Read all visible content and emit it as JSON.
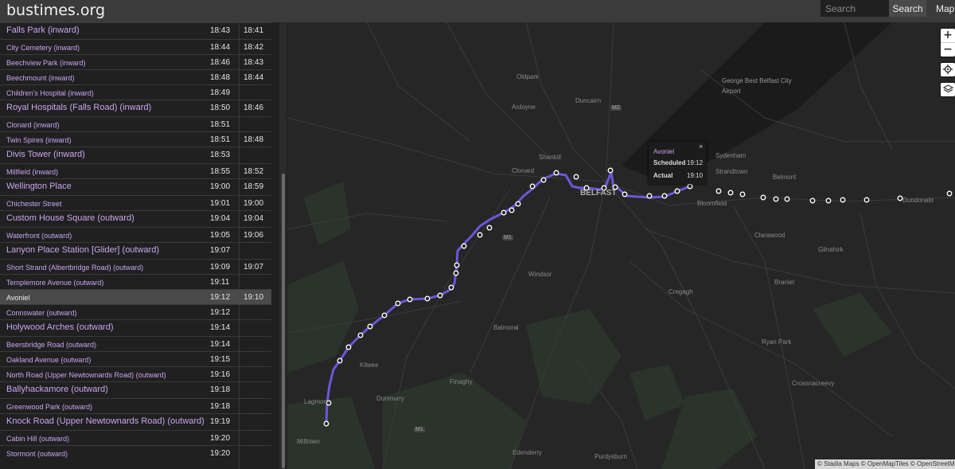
{
  "header": {
    "logo": "bustimes.org",
    "search_placeholder": "Search",
    "search_button": "Search",
    "map_link": "Map"
  },
  "timetable": [
    {
      "stop": "Falls Park (inward)",
      "major": true,
      "scheduled": "18:43",
      "actual": "18:41"
    },
    {
      "stop": "City Cemetery (inward)",
      "major": false,
      "scheduled": "18:44",
      "actual": "18:42"
    },
    {
      "stop": "Beechview Park (inward)",
      "major": false,
      "scheduled": "18:46",
      "actual": "18:43"
    },
    {
      "stop": "Beechmount (inward)",
      "major": false,
      "scheduled": "18:48",
      "actual": "18:44"
    },
    {
      "stop": "Children's Hospital (inward)",
      "major": false,
      "scheduled": "18:49",
      "actual": ""
    },
    {
      "stop": "Royal Hospitals (Falls Road) (inward)",
      "major": true,
      "scheduled": "18:50",
      "actual": "18:46"
    },
    {
      "stop": "Clonard (inward)",
      "major": false,
      "scheduled": "18:51",
      "actual": ""
    },
    {
      "stop": "Twin Spires (inward)",
      "major": false,
      "scheduled": "18:51",
      "actual": "18:48"
    },
    {
      "stop": "Divis Tower (inward)",
      "major": true,
      "scheduled": "18:53",
      "actual": ""
    },
    {
      "stop": "Millfield (inward)",
      "major": false,
      "scheduled": "18:55",
      "actual": "18:52"
    },
    {
      "stop": "Wellington Place",
      "major": true,
      "scheduled": "19:00",
      "actual": "18:59"
    },
    {
      "stop": "Chichester Street",
      "major": false,
      "scheduled": "19:01",
      "actual": "19:00"
    },
    {
      "stop": "Custom House Square (outward)",
      "major": true,
      "scheduled": "19:04",
      "actual": "19:04"
    },
    {
      "stop": "Waterfront (outward)",
      "major": false,
      "scheduled": "19:05",
      "actual": "19:06"
    },
    {
      "stop": "Lanyon Place Station [Glider] (outward)",
      "major": true,
      "scheduled": "19:07",
      "actual": ""
    },
    {
      "stop": "Short Strand (Albertbridge Road) (outward)",
      "major": false,
      "scheduled": "19:09",
      "actual": "19:07"
    },
    {
      "stop": "Templemore Avenue (outward)",
      "major": false,
      "scheduled": "19:11",
      "actual": ""
    },
    {
      "stop": "Avoniel",
      "major": false,
      "scheduled": "19:12",
      "actual": "19:10",
      "selected": true
    },
    {
      "stop": "Connswater (outward)",
      "major": false,
      "scheduled": "19:12",
      "actual": ""
    },
    {
      "stop": "Holywood Arches (outward)",
      "major": true,
      "scheduled": "19:14",
      "actual": ""
    },
    {
      "stop": "Beersbridge Road (outward)",
      "major": false,
      "scheduled": "19:14",
      "actual": ""
    },
    {
      "stop": "Oakland Avenue (outward)",
      "major": false,
      "scheduled": "19:15",
      "actual": ""
    },
    {
      "stop": "North Road (Upper Newtownards Road) (outward)",
      "major": false,
      "scheduled": "19:16",
      "actual": ""
    },
    {
      "stop": "Ballyhackamore (outward)",
      "major": true,
      "scheduled": "19:18",
      "actual": ""
    },
    {
      "stop": "Greenwood Park (outward)",
      "major": false,
      "scheduled": "19:18",
      "actual": ""
    },
    {
      "stop": "Knock Road (Upper Newtownards Road) (outward)",
      "major": true,
      "scheduled": "19:19",
      "actual": ""
    },
    {
      "stop": "Cabin Hill (outward)",
      "major": false,
      "scheduled": "19:20",
      "actual": ""
    },
    {
      "stop": "Stormont (outward)",
      "major": false,
      "scheduled": "19:20",
      "actual": ""
    }
  ],
  "map": {
    "places": {
      "oldpark": "Oldpark",
      "ardoyne": "Ardoyne",
      "duncairn": "Duncairn",
      "airport": "George Best Belfast City Airport",
      "sydenham": "Sydenham",
      "shankill": "Shankill",
      "clonard": "Clonard",
      "belfast": "BELFAST",
      "strandtown": "Strandtown",
      "belmont": "Belmont",
      "bloomfield": "Bloomfield",
      "dundonald": "Dundonald",
      "clarawood": "Clarawood",
      "gilnahirk": "Gilnahirk",
      "windsor": "Windsor",
      "braniel": "Braniel",
      "cregagh": "Cregagh",
      "balmoral": "Balmoral",
      "ryan_park": "Ryan Park",
      "kilwee": "Kilwee",
      "crossnacreevy": "Crossnacreevy",
      "finaghy": "Finaghy",
      "dunmurry": "Dunmurry",
      "lagmore": "Lagmore",
      "milltown": "Milltown",
      "edenderry": "Edenderry",
      "purdysburn": "Purdysburn"
    },
    "roads": {
      "m2": "M2",
      "m1a": "M1",
      "m1b": "M1"
    },
    "popup": {
      "title": "Avoniel",
      "scheduled_label": "Scheduled",
      "scheduled_value": "19:12",
      "actual_label": "Actual",
      "actual_value": "19:10",
      "close": "×"
    },
    "controls": {
      "zoom_in": "+",
      "zoom_out": "−"
    },
    "attribution": "© Stadia Maps © OpenMapTiles © OpenStreetMap",
    "route_color": "#6a58d8"
  }
}
